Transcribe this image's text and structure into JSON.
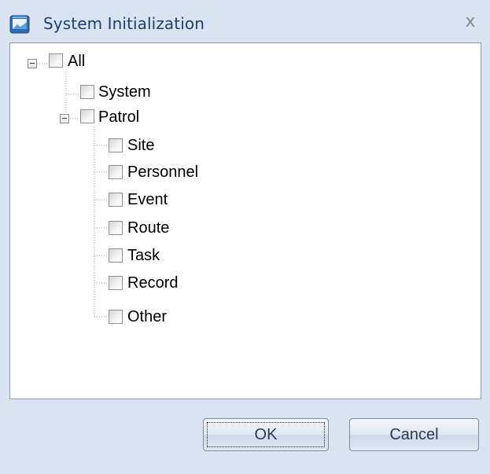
{
  "window": {
    "title": "System Initialization",
    "close_glyph": "x",
    "icon": "app-window-icon"
  },
  "tree": {
    "root": {
      "label": "All",
      "checked": false,
      "expanded": true
    },
    "items": [
      {
        "label": "System",
        "checked": false
      },
      {
        "label": "Patrol",
        "checked": false,
        "expanded": true
      }
    ],
    "patrol_children": [
      {
        "label": "Site",
        "checked": false
      },
      {
        "label": "Personnel",
        "checked": false
      },
      {
        "label": "Event",
        "checked": false
      },
      {
        "label": "Route",
        "checked": false
      },
      {
        "label": "Task",
        "checked": false
      },
      {
        "label": "Record",
        "checked": false
      },
      {
        "label": "Other",
        "checked": false
      }
    ]
  },
  "buttons": {
    "ok": "OK",
    "cancel": "Cancel"
  },
  "colors": {
    "dialog_background": "#d9e3f2",
    "title_text": "#1d3f72",
    "panel_border": "#8e9bb0"
  }
}
